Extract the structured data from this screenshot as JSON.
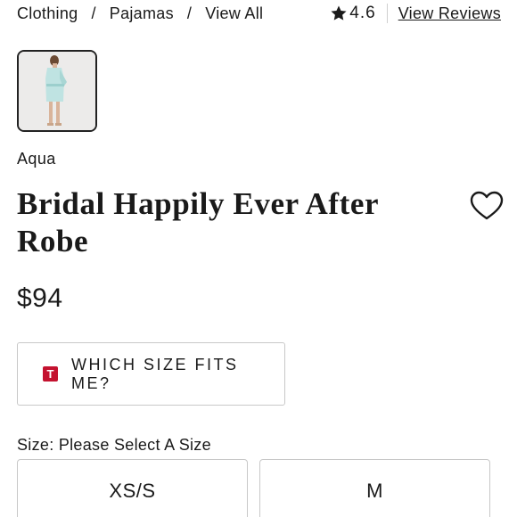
{
  "breadcrumb": {
    "items": [
      "Clothing",
      "Pajamas",
      "View All"
    ],
    "separator": "/"
  },
  "rating": {
    "icon": "star-icon",
    "value": "4.6",
    "reviews_label": "View Reviews"
  },
  "product": {
    "thumbnail_icon": "product-thumbnail",
    "color": "Aqua",
    "title_line1": "Bridal Happily Ever After",
    "title_line2": "Robe",
    "price": "$94",
    "wishlist_icon": "heart-icon"
  },
  "fit": {
    "badge": "T",
    "label": "WHICH SIZE FITS ME?",
    "badge_color": "#c4122f"
  },
  "size": {
    "label": "Size: Please Select A Size",
    "options": [
      "XS/S",
      "M"
    ]
  }
}
